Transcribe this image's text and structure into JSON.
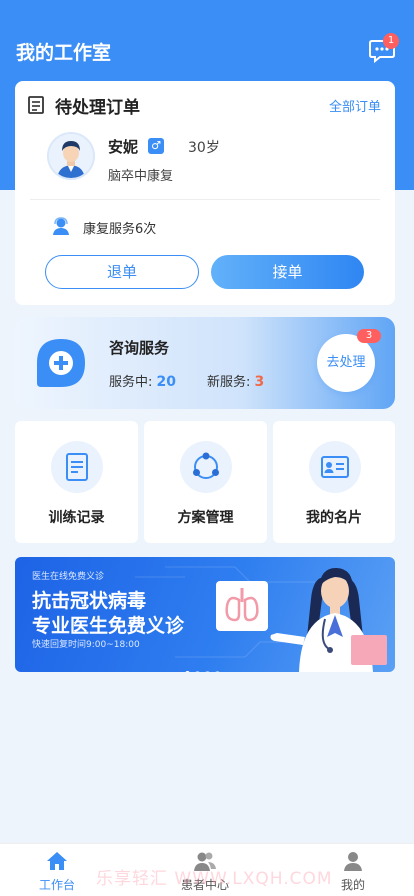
{
  "header": {
    "title": "我的工作室",
    "message_badge": "1"
  },
  "pending_orders": {
    "title": "待处理订单",
    "all_orders_link": "全部订单",
    "patient": {
      "name": "安妮",
      "gender_icon": "male-icon",
      "age": "30岁",
      "diagnosis": "脑卒中康复"
    },
    "service": "康复服务6次",
    "reject_label": "退单",
    "accept_label": "接单"
  },
  "consult": {
    "title": "咨询服务",
    "in_service_label": "服务中:",
    "in_service_count": "20",
    "new_label": "新服务:",
    "new_count": "3",
    "button_label": "去处理",
    "badge": "3"
  },
  "tiles": [
    {
      "label": "训练记录",
      "icon": "document-icon"
    },
    {
      "label": "方案管理",
      "icon": "cycle-icon"
    },
    {
      "label": "我的名片",
      "icon": "id-card-icon"
    }
  ],
  "banner": {
    "subtitle": "医生在线免费义诊",
    "title_line1": "抗击冠状病毒",
    "title_line2": "专业医生免费义诊",
    "note": "快速回复时间9:00~18:00"
  },
  "watermark": "乐享轻汇  WWW.LXQH.COM",
  "tabbar": [
    {
      "label": "工作台",
      "active": true
    },
    {
      "label": "患者中心",
      "active": false
    },
    {
      "label": "我的",
      "active": false
    }
  ],
  "colors": {
    "primary": "#3a8ef5",
    "badge": "#ff5f5f",
    "highlight_red": "#f06a4a"
  }
}
